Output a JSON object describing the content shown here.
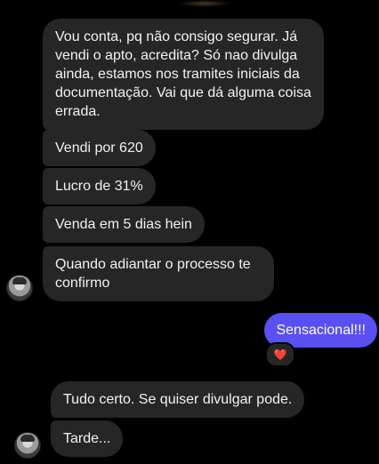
{
  "messages": {
    "m1": "Vou conta, pq não consigo segurar. Já vendi o apto, acredita? Só nao divulga ainda, estamos nos tramites iniciais da documentação. Vai que dá alguma coisa errada.",
    "m2": "Vendi por 620",
    "m3": "Lucro de 31%",
    "m4": "Venda em 5 dias hein",
    "m5": "Quando adiantar o processo te confirmo",
    "sent1": "Sensacional!!!",
    "reaction": "❤️",
    "m6": "Tudo certo. Se quiser divulgar pode.",
    "m7": "Tarde..."
  },
  "colors": {
    "background": "#000000",
    "received_bubble": "#262626",
    "sent_bubble": "#5a4ff0"
  },
  "icons": {
    "avatar": "contact-avatar-icon",
    "reaction": "heart-reaction-icon"
  }
}
